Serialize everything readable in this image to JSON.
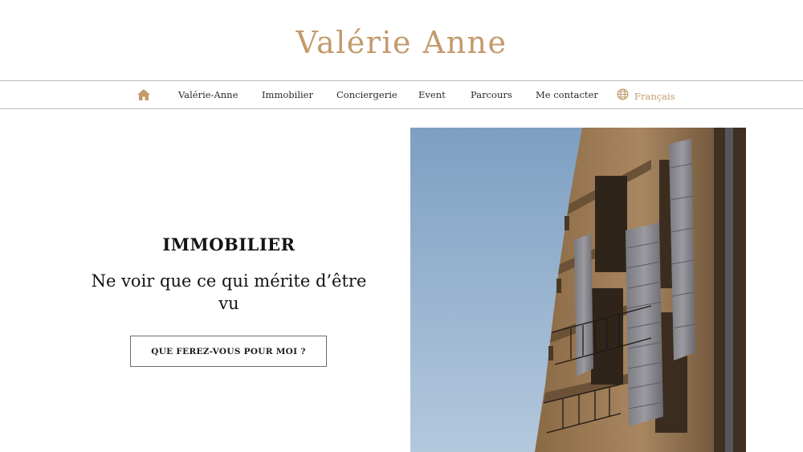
{
  "header": {
    "logo_text": "Valérie Anne"
  },
  "nav": {
    "home_icon": "home-icon",
    "items": [
      {
        "label": "Valérie-Anne"
      },
      {
        "label": "Immobilier"
      },
      {
        "label": "Conciergerie"
      },
      {
        "label": "Event"
      },
      {
        "label": "Parcours"
      },
      {
        "label": "Me contacter"
      }
    ],
    "language": {
      "icon": "globe-icon",
      "label": "Français"
    }
  },
  "hero": {
    "kicker": "IMMOBILIER",
    "title": "Ne voir que ce qui mérite d’être vu",
    "cta_label": "QUE FEREZ-VOUS POUR MOI ?"
  },
  "colors": {
    "accent": "#c49a6c",
    "text": "#1a1a1a",
    "divider": "#bdbdbd"
  }
}
